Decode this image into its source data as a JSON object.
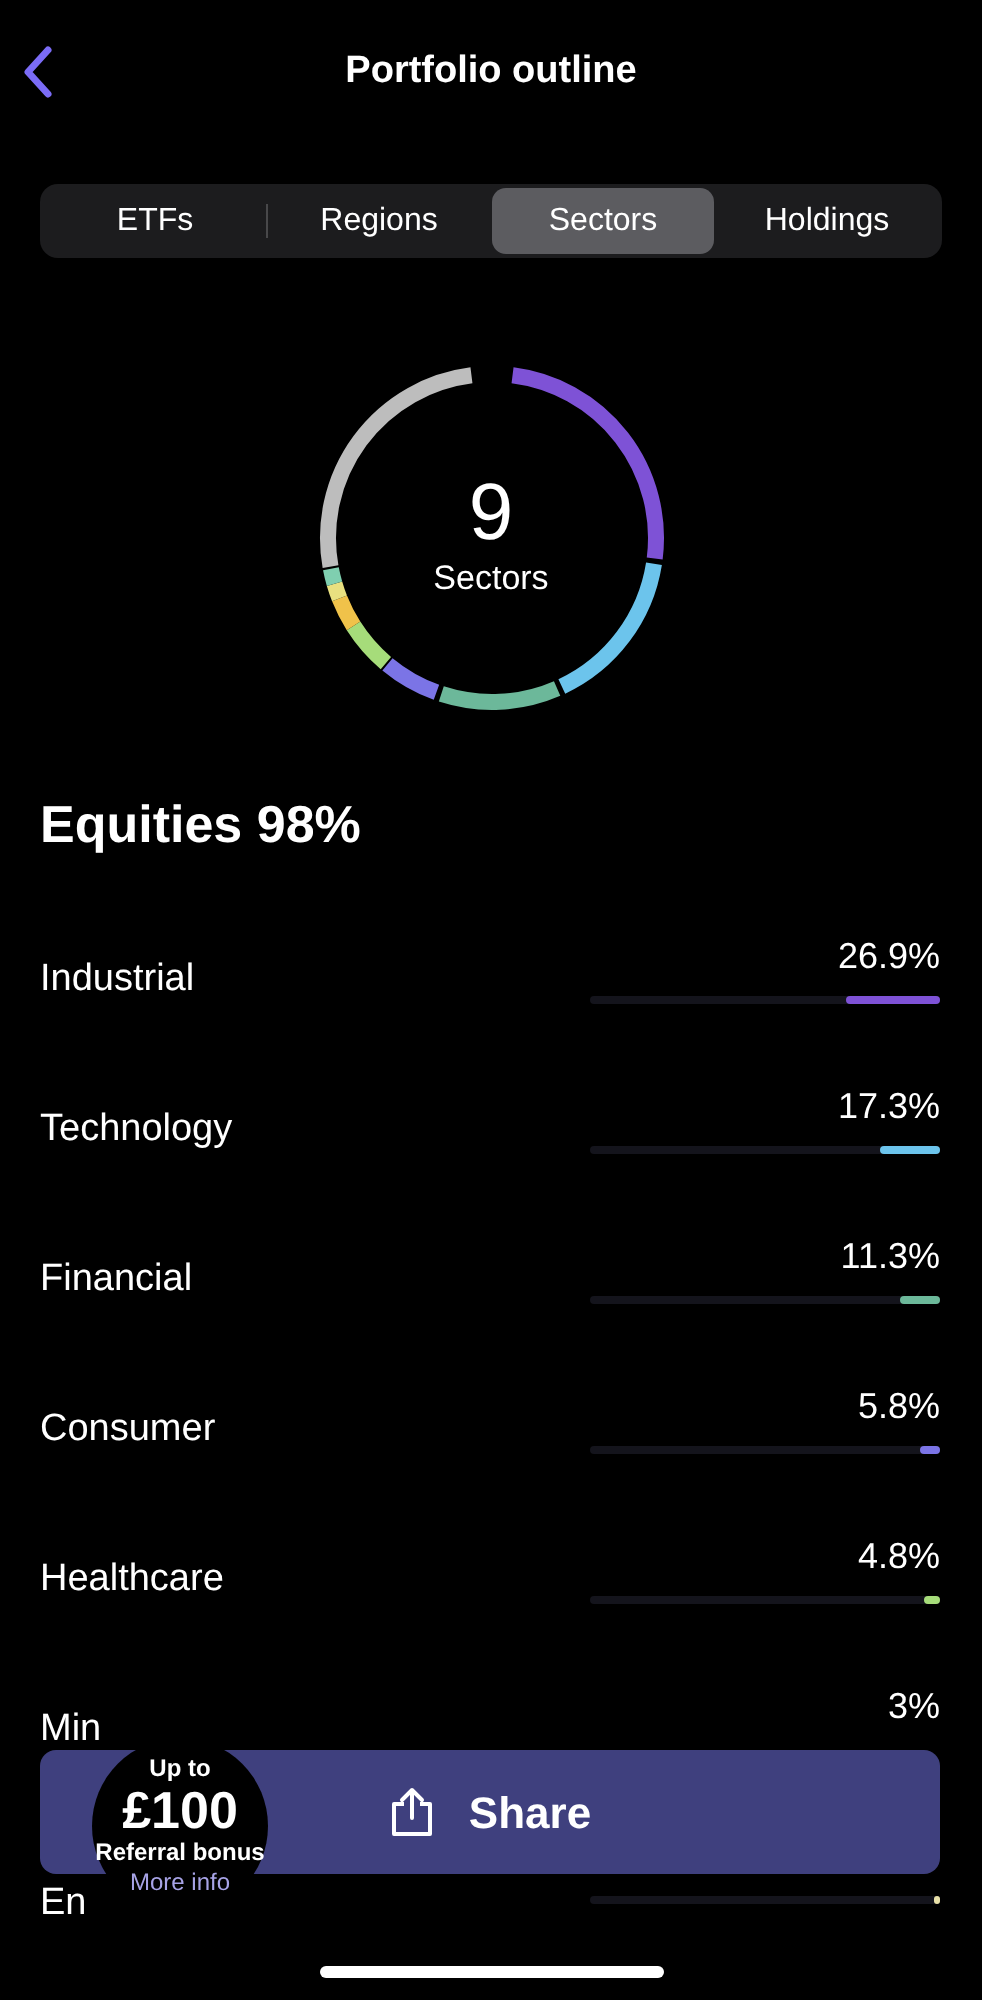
{
  "header": {
    "title": "Portfolio outline"
  },
  "tabs": [
    {
      "label": "ETFs",
      "selected": false
    },
    {
      "label": "Regions",
      "selected": false
    },
    {
      "label": "Sectors",
      "selected": true
    },
    {
      "label": "Holdings",
      "selected": false
    }
  ],
  "donut": {
    "count": "9",
    "caption": "Sectors"
  },
  "section_title": "Equities 98%",
  "sectors": [
    {
      "label": "Industrial",
      "value": "26.9%",
      "level": 0.269,
      "color": "#7e52d6"
    },
    {
      "label": "Technology",
      "value": "17.3%",
      "level": 0.173,
      "color": "#6cc4ec"
    },
    {
      "label": "Financial",
      "value": "11.3%",
      "level": 0.113,
      "color": "#6cb89a"
    },
    {
      "label": "Consumer",
      "value": "5.8%",
      "level": 0.058,
      "color": "#7b74e6"
    },
    {
      "label": "Healthcare",
      "value": "4.8%",
      "level": 0.048,
      "color": "#a6dc7a"
    },
    {
      "label": "Min",
      "value": "3%"
    },
    {
      "label": "En",
      "level": 0.02,
      "color": "#e8e0a8"
    }
  ],
  "share_button": {
    "label": "Share"
  },
  "referral": {
    "lead": "Up to",
    "amount": "£100",
    "caption": "Referral bonus",
    "link": "More info"
  }
}
